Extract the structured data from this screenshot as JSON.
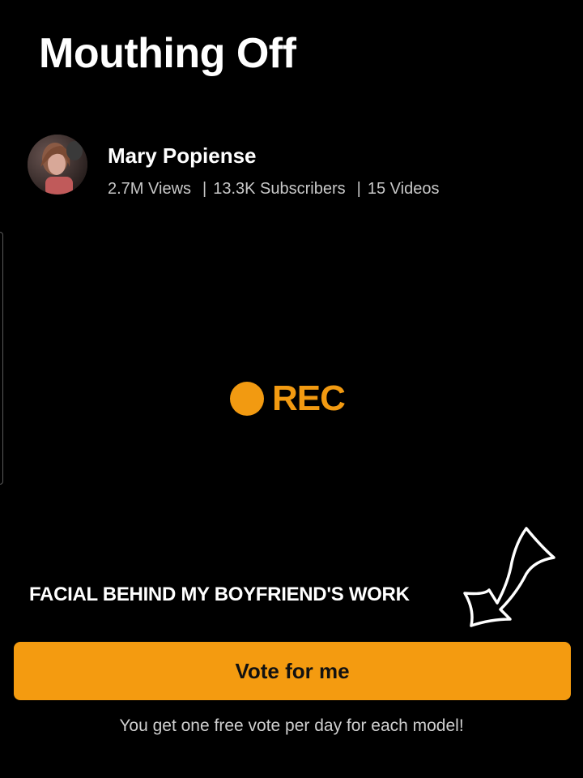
{
  "page": {
    "title": "Mouthing Off"
  },
  "channel": {
    "name": "Mary Popiense",
    "views": "2.7M Views",
    "subscribers": "13.3K Subscribers",
    "videos": "15 Videos",
    "separator": "|"
  },
  "recording": {
    "label": "REC",
    "color": "#F29A11"
  },
  "video": {
    "title": "FACIAL BEHIND MY BOYFRIEND'S WORK"
  },
  "vote": {
    "button_label": "Vote for me",
    "note": "You get one free vote per day for each model!",
    "button_color": "#F49B10"
  },
  "icons": {
    "avatar": "avatar-photo",
    "rec_indicator": "record-dot-icon",
    "annotation": "hand-drawn-arrow-icon"
  }
}
